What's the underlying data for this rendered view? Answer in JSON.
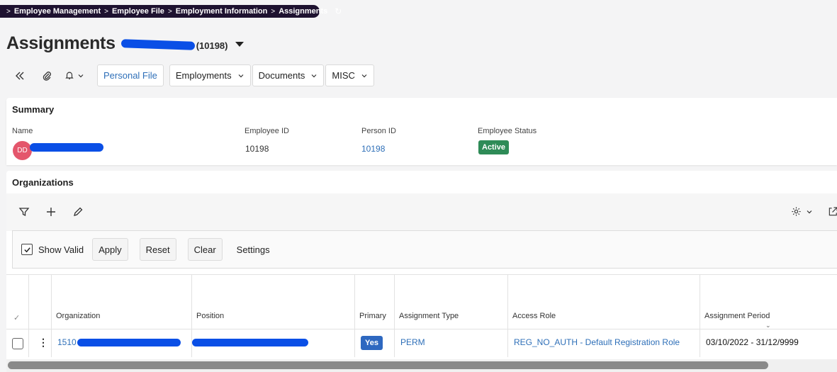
{
  "breadcrumb": {
    "items": [
      "Employee Management",
      "Employee File",
      "Employment Information",
      "Assignments"
    ],
    "refresh_icon": "refresh-icon"
  },
  "title": {
    "text": "Assignments",
    "id": "(10198)"
  },
  "toolbar": {
    "personal_file": "Personal File",
    "employments": "Employments",
    "documents": "Documents",
    "misc": "MISC"
  },
  "summary": {
    "title": "Summary",
    "name_label": "Name",
    "avatar_initials": "DD",
    "employee_id_label": "Employee ID",
    "employee_id": "10198",
    "person_id_label": "Person ID",
    "person_id": "10198",
    "status_label": "Employee Status",
    "status": "Active"
  },
  "organizations": {
    "title": "Organizations",
    "show_valid": "Show Valid",
    "apply": "Apply",
    "reset": "Reset",
    "clear": "Clear",
    "settings": "Settings",
    "columns": [
      "Organization",
      "Position",
      "Primary",
      "Assignment Type",
      "Access Role",
      "Assignment Period"
    ],
    "rows": [
      {
        "organization": "1510",
        "primary": "Yes",
        "assignment_type": "PERM",
        "access_role": "REG_NO_AUTH - Default Registration Role",
        "assignment_period": "03/10/2022 - 31/12/9999"
      }
    ]
  },
  "colors": {
    "accent": "#2e6fb8",
    "breadcrumb_bg": "#1e1230",
    "active": "#2e8b57",
    "redaction": "#0a4fe6"
  }
}
